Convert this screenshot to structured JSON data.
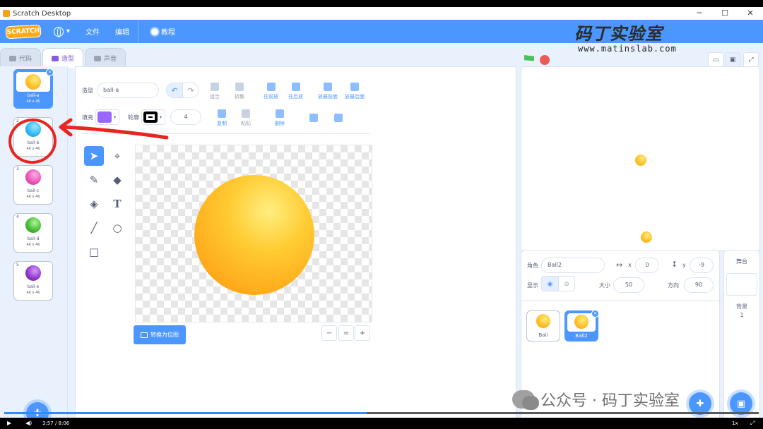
{
  "window": {
    "title": "Scratch Desktop",
    "min": "─",
    "max": "☐",
    "close": "✕"
  },
  "menubar": {
    "logo": "SCRATCH",
    "file": "文件",
    "edit": "编辑",
    "tutorials": "教程"
  },
  "watermark": {
    "title": "码丁实验室",
    "url": "www.matinslab.com",
    "wechat": "公众号 · 码丁实验室"
  },
  "tabs": [
    {
      "label": "代码"
    },
    {
      "label": "造型"
    },
    {
      "label": "声音"
    }
  ],
  "costumes": [
    {
      "num": "1",
      "name": "ball-a",
      "size": "46 x 46",
      "color": "#ffb319"
    },
    {
      "num": "2",
      "name": "ball-b",
      "size": "46 x 46",
      "color": "#29b6f6"
    },
    {
      "num": "3",
      "name": "ball-c",
      "size": "46 x 46",
      "color": "#e84cb5"
    },
    {
      "num": "4",
      "name": "ball-d",
      "size": "46 x 46",
      "color": "#3db82e"
    },
    {
      "num": "5",
      "name": "ball-e",
      "size": "46 x 46",
      "color": "#8e30c7"
    }
  ],
  "editor": {
    "costume_label": "造型",
    "costume_name": "ball-a",
    "group": "组合",
    "ungroup": "拆散",
    "forward": "往前放",
    "backward": "往后放",
    "front": "放最前面",
    "back": "放最后面",
    "fill_label": "填充",
    "fill_color": "#9966ff",
    "outline_label": "轮廓",
    "outline_color": "#000000",
    "outline_width": "4",
    "copy": "复制",
    "paste": "粘贴",
    "delete": "删除",
    "convert_bitmap": "转换为位图",
    "zoom_out": "−",
    "zoom_reset": "=",
    "zoom_in": "+"
  },
  "sprite": {
    "label": "角色",
    "name": "Ball2",
    "x_label": "x",
    "x": "0",
    "y_label": "y",
    "y": "-9",
    "show_label": "显示",
    "size_label": "大小",
    "size": "50",
    "direction_label": "方向",
    "direction": "90"
  },
  "sprites": [
    {
      "name": "Ball"
    },
    {
      "name": "Ball2"
    }
  ],
  "stage_selector": {
    "title": "舞台",
    "backdrops_label": "背景",
    "backdrops_count": "1"
  },
  "player": {
    "time": "3:57 / 8:06",
    "speed": "1x"
  }
}
